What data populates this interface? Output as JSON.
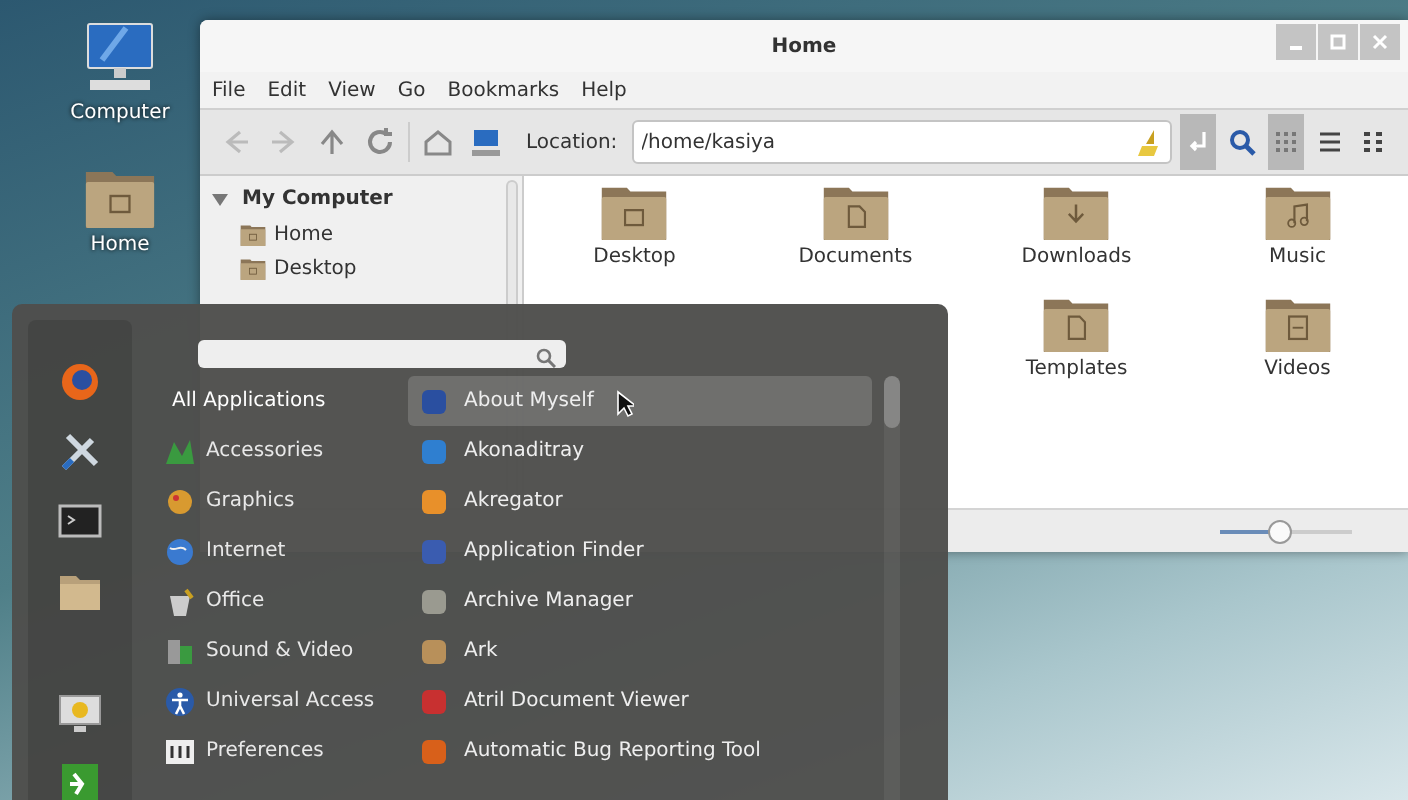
{
  "desktop_icons": [
    {
      "label": "Computer",
      "kind": "computer"
    },
    {
      "label": "Home",
      "kind": "home"
    }
  ],
  "window": {
    "title": "Home",
    "menu": [
      "File",
      "Edit",
      "View",
      "Go",
      "Bookmarks",
      "Help"
    ],
    "toolbar": {
      "nav": [
        {
          "kind": "back",
          "disabled": true
        },
        {
          "kind": "forward",
          "disabled": true
        },
        {
          "kind": "up",
          "disabled": false
        },
        {
          "kind": "reload",
          "disabled": false
        }
      ],
      "location_label": "Location:",
      "location": "/home/kasiya",
      "location_toggle_on": true,
      "views": [
        {
          "kind": "grid",
          "selected": true
        },
        {
          "kind": "list",
          "selected": false
        },
        {
          "kind": "compact",
          "selected": false
        }
      ]
    },
    "sidebar": {
      "title": "My Computer",
      "expanded": true,
      "items": [
        "Home",
        "Desktop"
      ]
    },
    "folders": [
      {
        "label": "Desktop",
        "kind": "desktop"
      },
      {
        "label": "Documents",
        "kind": "documents"
      },
      {
        "label": "Downloads",
        "kind": "downloads"
      },
      {
        "label": "Music",
        "kind": "music"
      },
      {
        "kind": "hidden"
      },
      {
        "kind": "hidden"
      },
      {
        "label": "Templates",
        "kind": "templates"
      },
      {
        "label": "Videos",
        "kind": "videos"
      }
    ],
    "zoom": {
      "level": 0.45
    }
  },
  "menu": {
    "favorites": [
      {
        "kind": "browser"
      },
      {
        "kind": "tools"
      },
      {
        "kind": "terminal"
      },
      {
        "kind": "folder"
      },
      {
        "kind": "lock"
      },
      {
        "kind": "logout"
      }
    ],
    "categories": [
      {
        "label": "All Applications",
        "kind": "all",
        "selected": true
      },
      {
        "label": "Accessories",
        "kind": "accessories",
        "selected": false
      },
      {
        "label": "Graphics",
        "kind": "graphics",
        "selected": false
      },
      {
        "label": "Internet",
        "kind": "internet",
        "selected": false
      },
      {
        "label": "Office",
        "kind": "office",
        "selected": false
      },
      {
        "label": "Sound & Video",
        "kind": "sound",
        "selected": false
      },
      {
        "label": "Universal Access",
        "kind": "access",
        "selected": false
      },
      {
        "label": "Preferences",
        "kind": "prefs",
        "selected": false
      }
    ],
    "apps": [
      {
        "label": "About Myself",
        "color": "#2a4fa0",
        "selected": true
      },
      {
        "label": "Akonaditray",
        "color": "#2f7fd0",
        "selected": false
      },
      {
        "label": "Akregator",
        "color": "#e8902a",
        "selected": false
      },
      {
        "label": "Application Finder",
        "color": "#3a5cb0",
        "selected": false
      },
      {
        "label": "Archive Manager",
        "color": "#9a9a90",
        "selected": false
      },
      {
        "label": "Ark",
        "color": "#b8905a",
        "selected": false
      },
      {
        "label": "Atril Document Viewer",
        "color": "#c83030",
        "selected": false
      },
      {
        "label": "Automatic Bug Reporting Tool",
        "color": "#d8601a",
        "selected": false
      }
    ]
  }
}
